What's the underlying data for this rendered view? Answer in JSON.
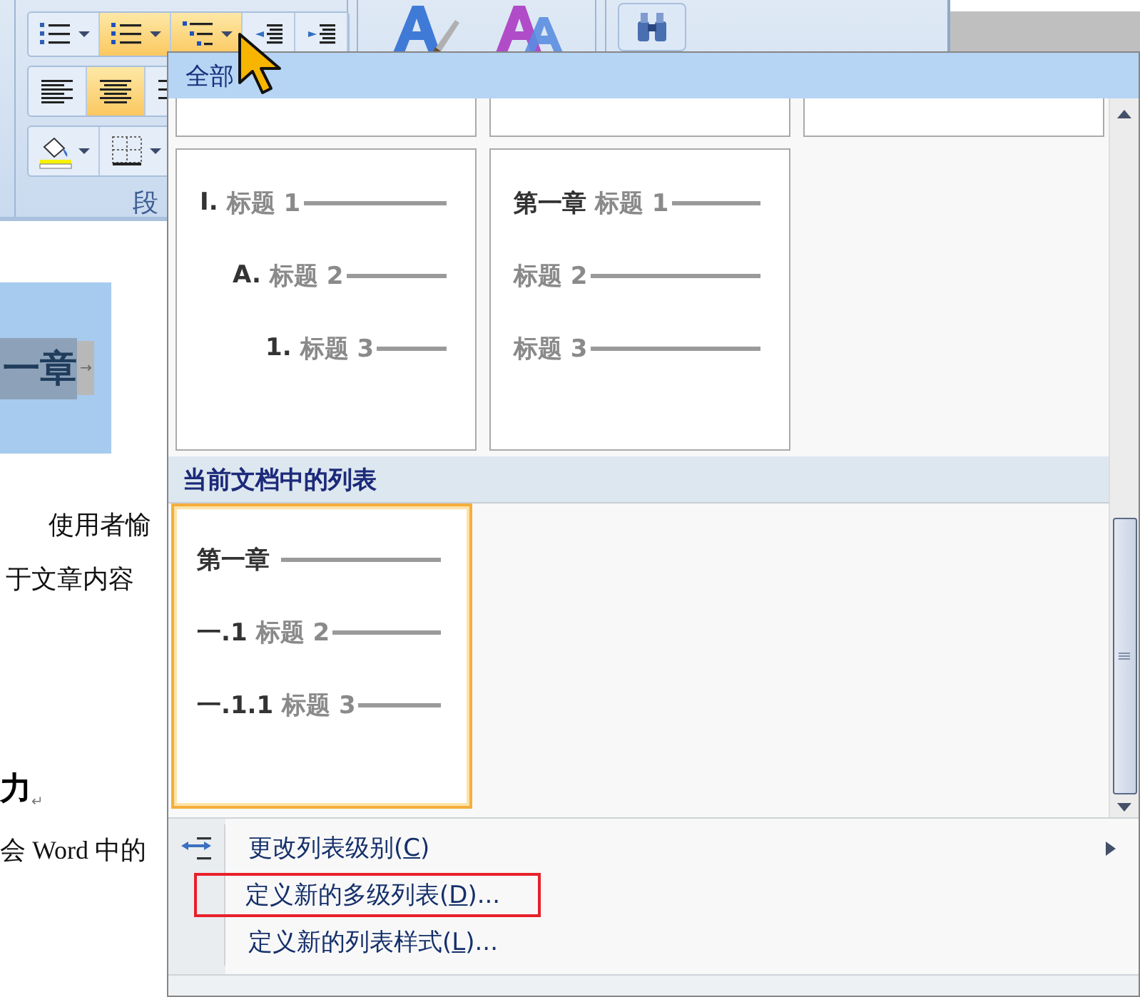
{
  "ribbon": {
    "rows": [
      [
        {
          "kind": "bullets",
          "selected": false,
          "dropdown": true
        },
        {
          "kind": "numbering",
          "selected": true,
          "dropdown": true
        },
        {
          "kind": "multilevel",
          "selected": true,
          "dropdown": true
        },
        {
          "kind": "outdent",
          "selected": false,
          "dropdown": false
        },
        {
          "kind": "indent",
          "selected": false,
          "dropdown": false
        }
      ],
      [
        {
          "kind": "align-left",
          "selected": false,
          "dropdown": false
        },
        {
          "kind": "align-center",
          "selected": true,
          "dropdown": false
        },
        {
          "kind": "align-right",
          "selected": false,
          "dropdown": false
        }
      ],
      [
        {
          "kind": "shading",
          "selected": false,
          "dropdown": true
        },
        {
          "kind": "borders",
          "selected": false,
          "dropdown": true
        }
      ]
    ],
    "group_label": "段",
    "big_buttons": [
      {
        "kind": "style-a"
      },
      {
        "kind": "style-aa"
      }
    ],
    "find_button": {
      "kind": "find"
    }
  },
  "document": {
    "heading": {
      "text": "一章",
      "tab_mark": "→"
    },
    "paragraphs": [
      "使用者愉",
      "于文章内容"
    ],
    "subheading": {
      "text": "力",
      "mark": "↵"
    },
    "paragraph2": "会 Word 中的"
  },
  "menu": {
    "header": "全部",
    "cards": [
      {
        "selected": false,
        "levels": [
          {
            "number": "I.",
            "text": "标题 1",
            "children": [
              {
                "number": "A.",
                "text": "标题 2",
                "children": [
                  {
                    "number": "1.",
                    "text": "标题 3"
                  }
                ]
              }
            ]
          }
        ]
      },
      {
        "selected": false,
        "levels": [
          {
            "number": "第一章",
            "text": "标题 1"
          },
          {
            "text": "标题 2"
          },
          {
            "text": "标题 3"
          }
        ]
      }
    ],
    "section": "当前文档中的列表",
    "current_cards": [
      {
        "selected": true,
        "levels": [
          {
            "number": "第一章"
          },
          {
            "number": "一.1",
            "text": "标题 2"
          },
          {
            "number": "一.1.1",
            "text": "标题 3"
          }
        ]
      }
    ],
    "items": [
      {
        "kind": "change-level",
        "text": "更改列表级别(",
        "key": "C",
        "tail": ")",
        "submenu": true,
        "outlined": false
      },
      {
        "kind": "plain",
        "text": "定义新的多级列表(",
        "key": "D",
        "tail": ")...",
        "submenu": false,
        "outlined": true
      },
      {
        "kind": "plain",
        "text": "定义新的列表样式(",
        "key": "L",
        "tail": ")...",
        "submenu": false,
        "outlined": false
      }
    ]
  }
}
